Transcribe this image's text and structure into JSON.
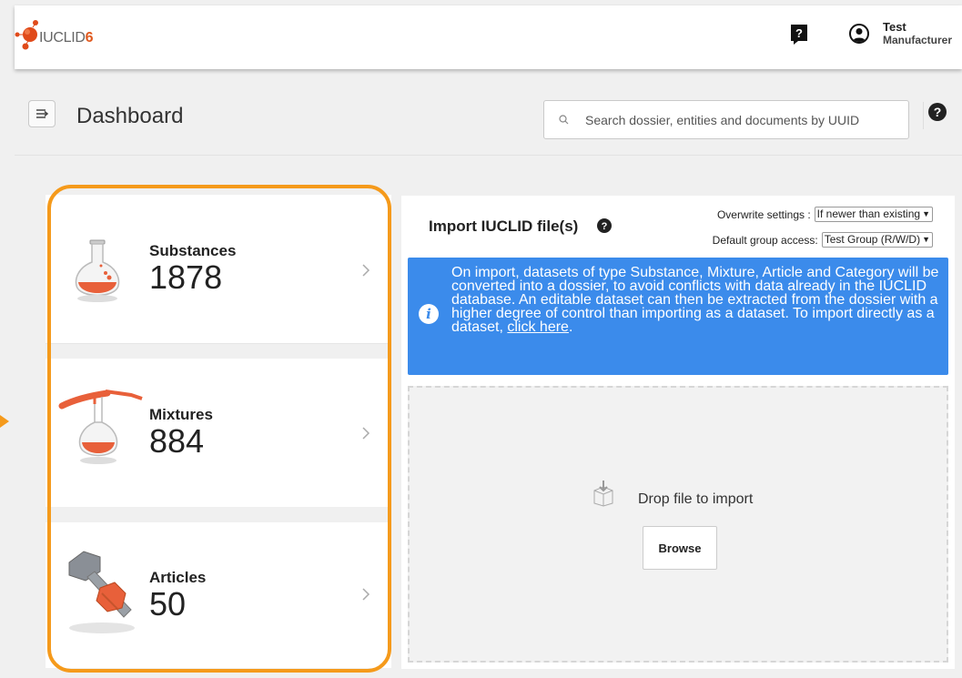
{
  "header": {
    "logo_text": "IUCLID",
    "logo_version": "6",
    "user_name": "Test",
    "user_role": "Manufacturer"
  },
  "page": {
    "title": "Dashboard",
    "search_placeholder": "Search dossier, entities and documents by UUID"
  },
  "entities": [
    {
      "label": "Substances",
      "count": "1878"
    },
    {
      "label": "Mixtures",
      "count": "884"
    },
    {
      "label": "Articles",
      "count": "50"
    }
  ],
  "import": {
    "title": "Import IUCLID file(s)",
    "overwrite_label": "Overwrite settings :",
    "overwrite_value": "If newer than existing",
    "group_label": "Default group access:",
    "group_value": "Test Group (R/W/D)",
    "info_text": "On import, datasets of type Substance, Mixture, Article and Category will be converted into a dossier, to avoid conflicts with data already in the IUCLID database. An editable dataset can then be extracted from the dossier with a higher degree of control than importing as a dataset. To import directly as a dataset, ",
    "info_link": "click here",
    "info_end": ".",
    "drop_text": "Drop file to import",
    "browse_label": "Browse"
  },
  "colors": {
    "accent_orange": "#f59a1b",
    "info_blue": "#3b8beb",
    "brand_orange": "#e05a1f"
  }
}
